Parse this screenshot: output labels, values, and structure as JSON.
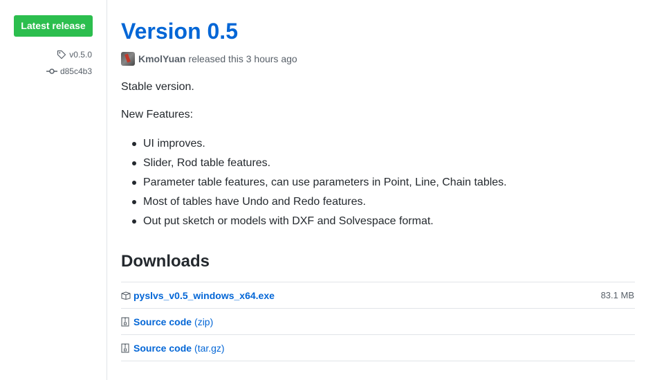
{
  "sidebar": {
    "badge_label": "Latest release",
    "tag": "v0.5.0",
    "commit": "d85c4b3"
  },
  "release": {
    "title": "Version 0.5",
    "author": "KmolYuan",
    "released_text": "released this 3 hours ago",
    "description": "Stable version.",
    "features_heading": "New Features:",
    "features": [
      "UI improves.",
      "Slider, Rod table features.",
      "Parameter table features, can use parameters in Point, Line, Chain tables.",
      "Most of tables have Undo and Redo features.",
      "Out put sketch or models with DXF and Solvespace format."
    ]
  },
  "downloads": {
    "heading": "Downloads",
    "items": [
      {
        "name": "pyslvs_v0.5_windows_x64.exe",
        "suffix": "",
        "size": "83.1 MB",
        "icon": "package-icon"
      },
      {
        "name": "Source code",
        "suffix": "(zip)",
        "size": "",
        "icon": "file-zip-icon"
      },
      {
        "name": "Source code",
        "suffix": "(tar.gz)",
        "size": "",
        "icon": "file-zip-icon"
      }
    ]
  },
  "colors": {
    "accent": "#0366d6",
    "badge": "#2cbe4e",
    "muted": "#586069",
    "border": "#e1e4e8"
  }
}
